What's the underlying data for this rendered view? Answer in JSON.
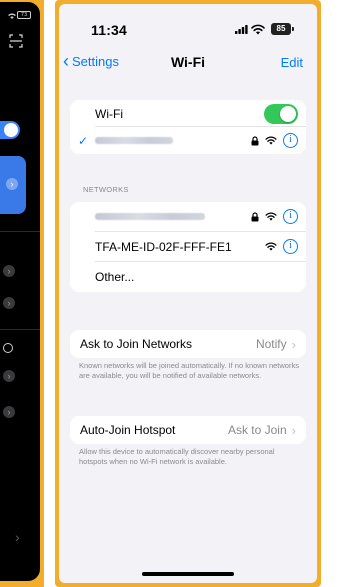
{
  "left_panel": {
    "battery": "73"
  },
  "status": {
    "time": "11:34",
    "battery": "85"
  },
  "nav": {
    "back_label": "Settings",
    "title": "Wi-Fi",
    "edit_label": "Edit"
  },
  "wifi_group": {
    "label": "Wi-Fi",
    "toggle_on": true
  },
  "networks": {
    "header": "NETWORKS",
    "items": [
      {
        "name": "TFA-ME-ID-02F-FFF-FE1"
      },
      {
        "name": "Other..."
      }
    ]
  },
  "ask_to_join": {
    "label": "Ask to Join Networks",
    "value": "Notify",
    "footnote": "Known networks will be joined automatically. If no known networks are available, you will be notified of available networks."
  },
  "auto_join": {
    "label": "Auto-Join Hotspot",
    "value": "Ask to Join",
    "footnote": "Allow this device to automatically discover nearby personal hotspots when no Wi-Fi network is available."
  },
  "colors": {
    "accent": "#007aff",
    "toggle_on": "#34c759",
    "frame": "#f2ad2d"
  },
  "icons": [
    "chevron-left-icon",
    "lock-icon",
    "wifi-icon",
    "info-icon",
    "checkmark-icon",
    "chevron-right-icon",
    "signal-icon",
    "battery-icon"
  ]
}
